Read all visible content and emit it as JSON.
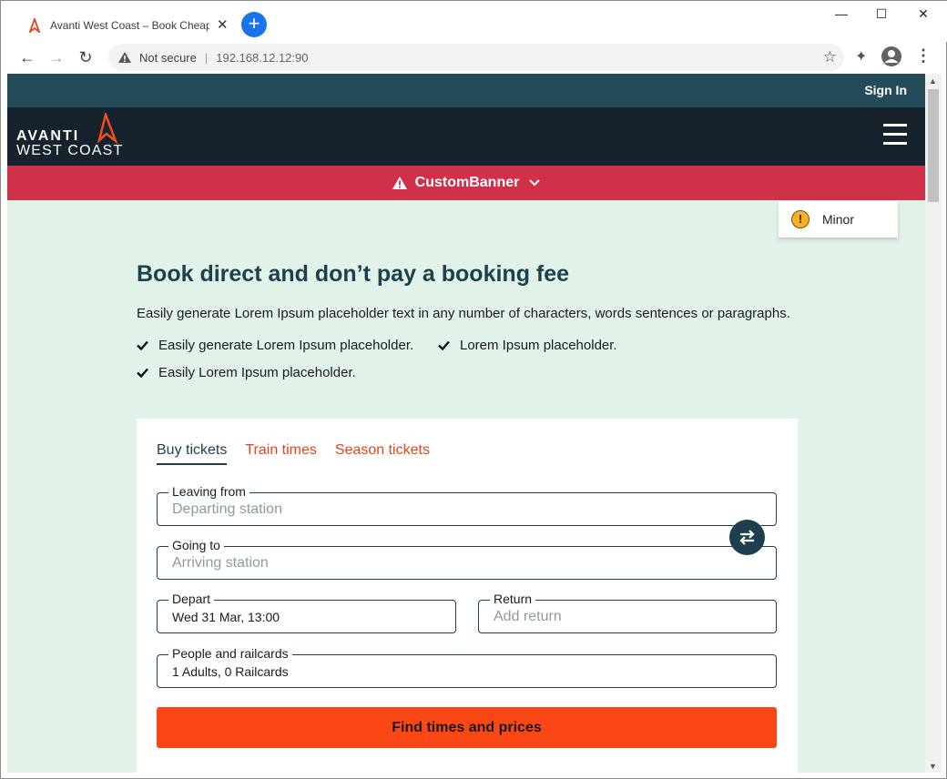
{
  "browser": {
    "tab_title": "Avanti West Coast – Book Cheap",
    "security_label": "Not secure",
    "url": "192.168.12.12:90"
  },
  "site": {
    "signin_label": "Sign In",
    "logo_line1": "AVANTI",
    "logo_line2": "WEST COAST",
    "banner_text": "CustomBanner",
    "minor_label": "Minor"
  },
  "hero": {
    "headline": "Book direct and don’t pay a booking fee",
    "intro": "Easily generate Lorem Ipsum placeholder text in any number of characters, words sentences or paragraphs.",
    "bullets": [
      "Easily generate Lorem Ipsum placeholder.",
      "Lorem Ipsum placeholder.",
      "Easily Lorem Ipsum placeholder."
    ]
  },
  "booking": {
    "tabs": [
      "Buy tickets",
      "Train times",
      "Season tickets"
    ],
    "leaving_label": "Leaving from",
    "leaving_placeholder": "Departing station",
    "going_label": "Going to",
    "going_placeholder": "Arriving station",
    "depart_label": "Depart",
    "depart_value": "Wed 31 Mar, 13:00",
    "return_label": "Return",
    "return_placeholder": "Add return",
    "people_label": "People and railcards",
    "people_value": "1 Adults, 0 Railcards",
    "find_button": "Find times and prices"
  },
  "colors": {
    "brand_dark": "#16232c",
    "topbar": "#234b5a",
    "banner": "#cf3248",
    "accent": "#fb4716",
    "page_bg": "#e1f3e9"
  }
}
